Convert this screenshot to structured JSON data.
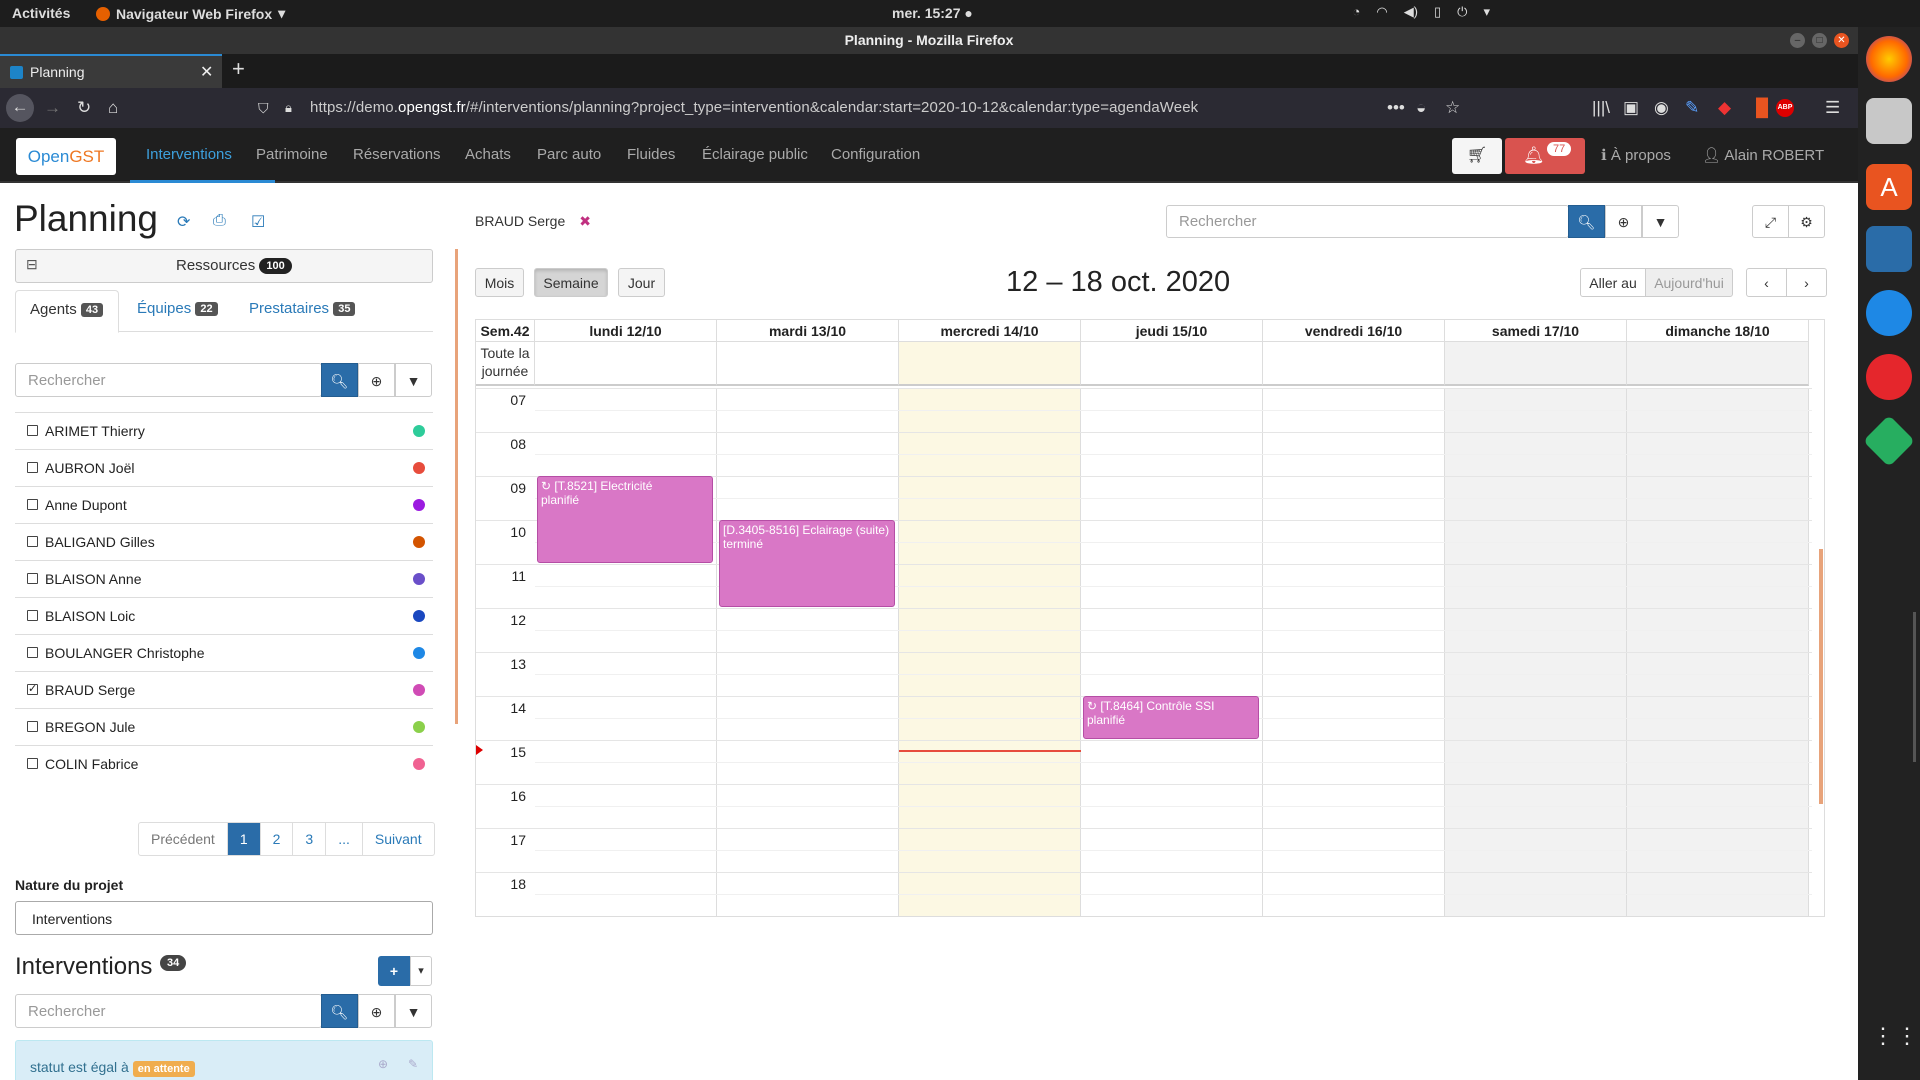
{
  "os": {
    "activities": "Activités",
    "app_name": "Navigateur Web Firefox",
    "clock": "mer. 15:27"
  },
  "window": {
    "title": "Planning - Mozilla Firefox"
  },
  "browser": {
    "tab_title": "Planning",
    "url_prefix": "https://demo.",
    "url_domain": "opengst.fr",
    "url_rest": "/#/interventions/planning?project_type=intervention&calendar:start=2020-10-12&calendar:type=agendaWeek"
  },
  "app": {
    "logo_a": "Open",
    "logo_b": "GST",
    "menu": [
      "Interventions",
      "Patrimoine",
      "Réservations",
      "Achats",
      "Parc auto",
      "Fluides",
      "Éclairage public",
      "Configuration"
    ],
    "notif_count": "77",
    "about": "À propos",
    "user": "Alain ROBERT"
  },
  "sidebar": {
    "title": "Planning",
    "resources_label": "Ressources",
    "resources_count": "100",
    "tabs": [
      {
        "label": "Agents",
        "count": "43"
      },
      {
        "label": "Équipes",
        "count": "22"
      },
      {
        "label": "Prestataires",
        "count": "35"
      }
    ],
    "search_placeholder": "Rechercher",
    "agents": [
      {
        "name": "ARIMET Thierry",
        "color": "#2ecc9a",
        "checked": false
      },
      {
        "name": "AUBRON Joël",
        "color": "#e74c3c",
        "checked": false
      },
      {
        "name": "Anne Dupont",
        "color": "#9b1be0",
        "checked": false
      },
      {
        "name": "BALIGAND Gilles",
        "color": "#d35400",
        "checked": false
      },
      {
        "name": "BLAISON Anne",
        "color": "#6a4fc9",
        "checked": false
      },
      {
        "name": "BLAISON Loic",
        "color": "#1a48c0",
        "checked": false
      },
      {
        "name": "BOULANGER Christophe",
        "color": "#1e88e5",
        "checked": false
      },
      {
        "name": "BRAUD Serge",
        "color": "#d04bb5",
        "checked": true
      },
      {
        "name": "BREGON Jule",
        "color": "#8bd04b",
        "checked": false
      },
      {
        "name": "COLIN Fabrice",
        "color": "#f06292",
        "checked": false
      }
    ],
    "pager": {
      "prev": "Précédent",
      "pages": [
        "1",
        "2",
        "3",
        "..."
      ],
      "next": "Suivant"
    },
    "nature_label": "Nature du projet",
    "nature_value": "Interventions",
    "interventions_title": "Interventions",
    "interventions_count": "34",
    "filter_text": "statut est égal à",
    "filter_value": "en attente"
  },
  "calendar": {
    "selected_agent": "BRAUD Serge",
    "search_placeholder": "Rechercher",
    "view_buttons": [
      "Mois",
      "Semaine",
      "Jour"
    ],
    "active_view": "Semaine",
    "title": "12 – 18 oct. 2020",
    "goto": "Aller au",
    "today": "Aujourd'hui",
    "week_label": "Sem.42",
    "allday_label": "Toute la journée",
    "days": [
      "lundi 12/10",
      "mardi 13/10",
      "mercredi 14/10",
      "jeudi 15/10",
      "vendredi 16/10",
      "samedi 17/10",
      "dimanche 18/10"
    ],
    "hours": [
      "07",
      "08",
      "09",
      "10",
      "11",
      "12",
      "13",
      "14",
      "15",
      "16",
      "17",
      "18"
    ],
    "events": [
      {
        "day": 0,
        "start": 9,
        "end": 11,
        "title": "[T.8521] Electricité",
        "status": "planifié",
        "recurring": true
      },
      {
        "day": 1,
        "start": 10,
        "end": 12,
        "title": "[D.3405-8516] Eclairage (suite)",
        "status": "terminé",
        "recurring": false
      },
      {
        "day": 3,
        "start": 14,
        "end": 15,
        "title": "[T.8464] Contrôle SSI",
        "status": "planifié",
        "recurring": true
      }
    ],
    "now_hour": 15.22,
    "today_index": 2
  }
}
